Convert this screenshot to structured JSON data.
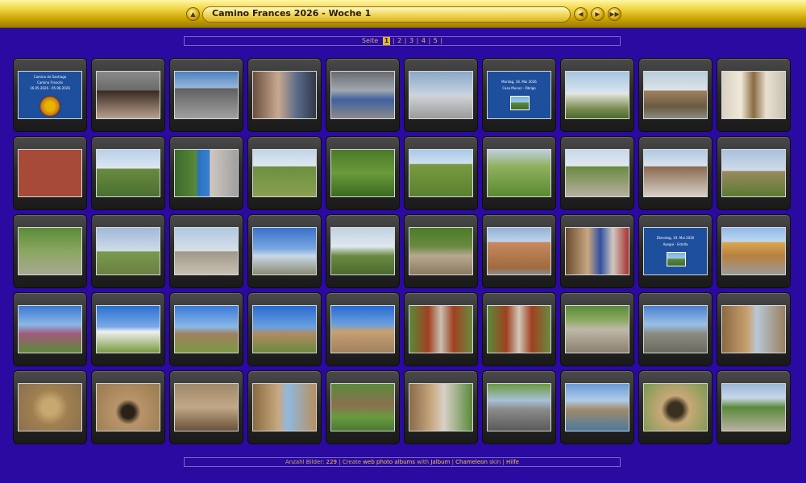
{
  "header": {
    "title": "Camino Frances 2026 - Woche 1",
    "icons": [
      "home-icon",
      "previous-icon",
      "play-icon",
      "next-icon"
    ]
  },
  "pager": {
    "label": "Seite",
    "pages": [
      "1",
      "2",
      "3",
      "4",
      "5"
    ],
    "current": "1"
  },
  "folders": {
    "f1": {
      "line1": "Camino de Santiago",
      "line2": "Camino Francés",
      "line3": "16.05.2026 - 05.06.2026"
    },
    "f2": {
      "line1": "Montag, 18. Mai 2026",
      "line2": "Casa Munoz - Obrigo"
    },
    "f3": {
      "line1": "Dienstag, 19. Mai 2026",
      "line2": "Ayegui - Estella"
    }
  },
  "footer": {
    "count_label": "Anzahl Bilder:",
    "count": "229",
    "create_label": "Create",
    "link_albums": "web photo albums",
    "with": "with",
    "link_jalbum": "Jalbum",
    "link_skin": "Chameleon",
    "skin": "skin",
    "link_help": "Hilfe"
  },
  "colors": {
    "background": "#2a0aa0",
    "topbar": "#f2d84a",
    "folder_bg": "#1d4f9c",
    "accent": "#e8c040"
  }
}
